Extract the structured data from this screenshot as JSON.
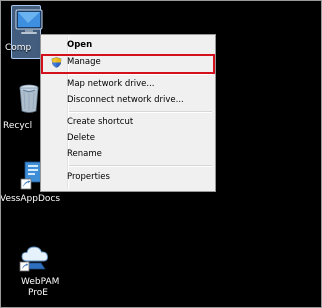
{
  "desktop": {
    "icons": [
      {
        "label": "Comp",
        "icon": "computer-icon"
      },
      {
        "label": "Recycl",
        "icon": "recycle-bin-icon"
      },
      {
        "label": "VessAppDocs",
        "icon": "shortcut-document-icon"
      },
      {
        "label_line1": "WebPAM",
        "label_line2": "ProE",
        "icon": "webpam-cloud-icon"
      }
    ]
  },
  "context_menu": {
    "items": [
      {
        "label": "Open",
        "bold": true
      },
      {
        "label": "Manage",
        "icon": "uac-shield-icon",
        "highlighted": true
      },
      {
        "label": "Map network drive..."
      },
      {
        "label": "Disconnect network drive..."
      },
      {
        "label": "Create shortcut"
      },
      {
        "label": "Delete"
      },
      {
        "label": "Rename"
      },
      {
        "label": "Properties"
      }
    ]
  },
  "colors": {
    "background": "#000000",
    "menu_bg": "#f0f0f0",
    "highlight_border": "#d4101c",
    "selection": "#a7c9f1"
  }
}
